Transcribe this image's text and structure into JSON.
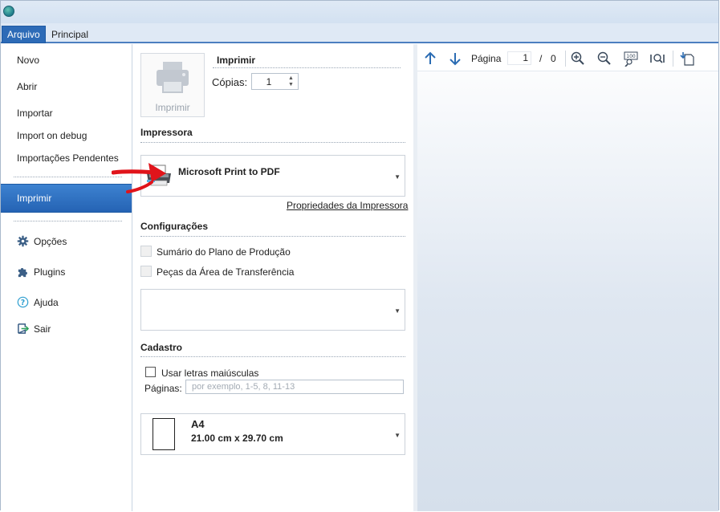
{
  "ribbon": {
    "tabs": [
      {
        "label": "Arquivo",
        "active": true
      },
      {
        "label": "Principal",
        "active": false
      }
    ]
  },
  "sidebar": {
    "items": [
      "Novo",
      "Abrir",
      "Importar",
      "Import on debug",
      "Importações Pendentes"
    ],
    "selected": "Imprimir",
    "icon_items": [
      {
        "label": "Opções",
        "icon": "gear-icon"
      },
      {
        "label": "Plugins",
        "icon": "puzzle-icon"
      },
      {
        "label": "Ajuda",
        "icon": "help-icon"
      },
      {
        "label": "Sair",
        "icon": "exit-icon"
      }
    ]
  },
  "print": {
    "button_label": "Imprimir",
    "title": "Imprimir",
    "copies_label": "Cópias:",
    "copies_value": "1"
  },
  "printer": {
    "section_label": "Impressora",
    "name": "Microsoft Print to PDF",
    "properties_link": "Propriedades da Impressora"
  },
  "settings": {
    "section_label": "Configurações",
    "options": [
      "Sumário do Plano de Produção",
      "Peças da Área de Transferência"
    ]
  },
  "cadastro": {
    "section_label": "Cadastro",
    "uppercase_label": "Usar letras maiúsculas",
    "pages_label": "Páginas:",
    "pages_placeholder": "por exemplo, 1-5, 8, 11-13"
  },
  "paper": {
    "name": "A4",
    "size": "21.00 cm x 29.70 cm"
  },
  "preview_toolbar": {
    "page_label": "Página",
    "current_page": "1",
    "separator": "/",
    "total_pages": "0"
  },
  "colors": {
    "accent": "#2d6bb7",
    "arrow": "#e0141b"
  }
}
